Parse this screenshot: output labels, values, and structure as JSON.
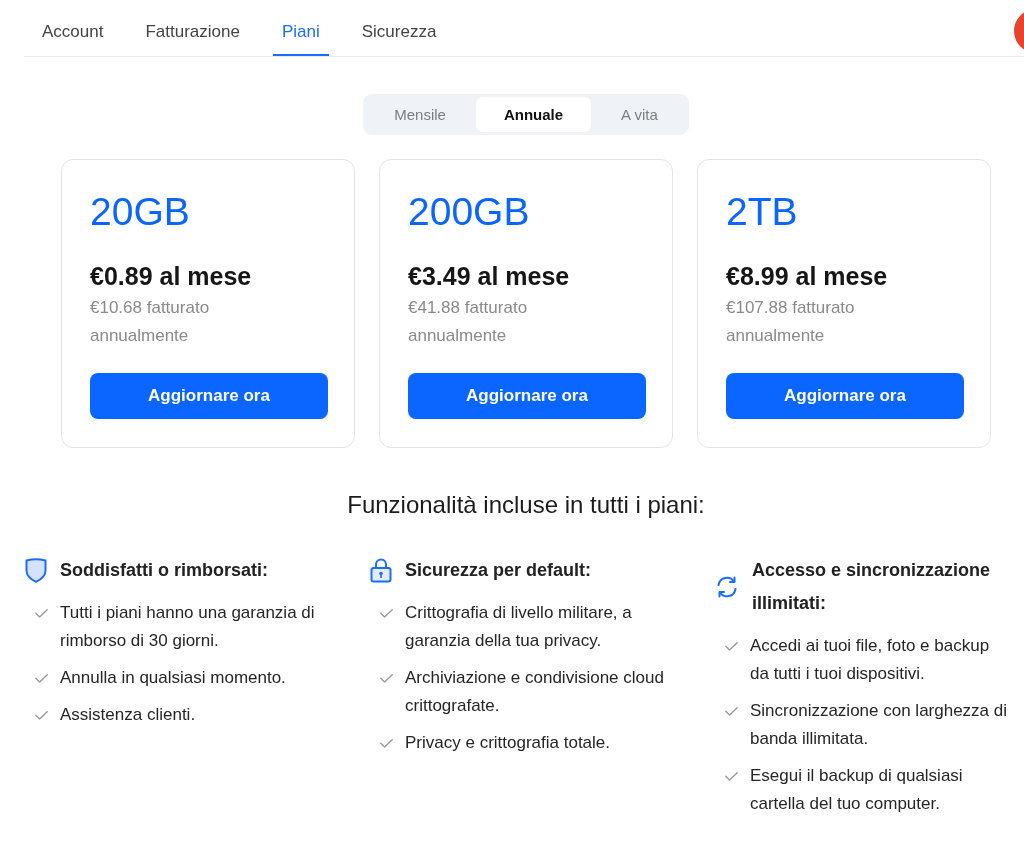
{
  "tabs": [
    {
      "label": "Account",
      "selected": false
    },
    {
      "label": "Fatturazione",
      "selected": false
    },
    {
      "label": "Piani",
      "selected": true
    },
    {
      "label": "Sicurezza",
      "selected": false
    }
  ],
  "billing_period": [
    {
      "label": "Mensile",
      "selected": false
    },
    {
      "label": "Annuale",
      "selected": true
    },
    {
      "label": "A vita",
      "selected": false
    }
  ],
  "plans": [
    {
      "storage": "20GB",
      "price": "€0.89 al mese",
      "billing_note": "€10.68 fatturato annualmente",
      "button": "Aggiornare ora"
    },
    {
      "storage": "200GB",
      "price": "€3.49 al mese",
      "billing_note": "€41.88 fatturato annualmente",
      "button": "Aggiornare ora"
    },
    {
      "storage": "2TB",
      "price": "€8.99 al mese",
      "billing_note": "€107.88 fatturato annualmente",
      "button": "Aggiornare ora"
    }
  ],
  "features": {
    "title": "Funzionalità incluse in tutti i piani:",
    "groups": [
      {
        "title": "Soddisfatti o rimborsati:",
        "items": [
          "Tutti i piani hanno una garanzia di rimborso di 30 giorni.",
          "Annulla in qualsiasi momento.",
          "Assistenza clienti."
        ]
      },
      {
        "title": "Sicurezza per default:",
        "items": [
          "Crittografia di livello militare, a garanzia della tua privacy.",
          "Archiviazione e condivisione cloud crittografate.",
          "Privacy e crittografia totale."
        ]
      },
      {
        "title": "Accesso e sincronizzazione illimitati:",
        "items": [
          "Accedi ai tuoi file, foto e backup da tutti i tuoi dispositivi.",
          "Sincronizzazione con larghezza di banda illimitata.",
          "Esegui il backup di qualsiasi cartella del tuo computer."
        ]
      }
    ]
  }
}
